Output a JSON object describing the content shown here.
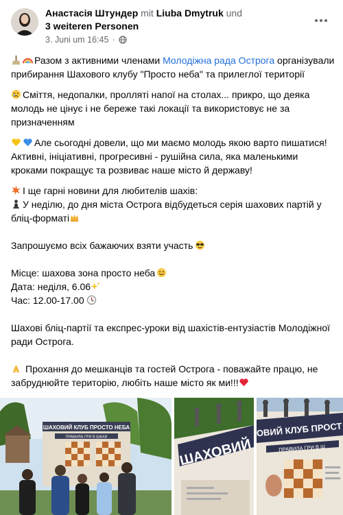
{
  "post": {
    "author": "Анастасія Штундер",
    "with_word": "mit",
    "tagged": "Liuba Dmytruk",
    "and_word": "und",
    "others": "3 weiteren Personen",
    "date": "3. Juni um 16:45",
    "audience_icon": "globe-icon",
    "more_icon": "more-options-icon"
  },
  "text": {
    "p1_a": "Разом з активними членами",
    "p1_link": "Молодіжна рада Острога",
    "p1_b": "організували прибирання Шахового клубу \"Просто неба\" та прилеглої території",
    "p2": "Сміття, недопалки, пролляті напої на столах... прикро, що деяка молодь не цінує і не береже такі локації та використовує не за призначенням",
    "p3": "Але сьогодні довели, що ми маємо молодь якою варто пишатися! Активні, ініціативні, прогресивні - рушійна сила, яка маленькими кроками покращує та розвиває наше місто й державу!",
    "p4": "І ще гарні новини для любителів шахів:",
    "p5": "У неділю, до дня міста Острога відбудеться серія шахових партій у бліц-форматі",
    "p6": "Запрошуємо всіх бажаючих взяти участь",
    "p7": "Місце: шахова зона просто неба",
    "p8": "Дата: неділя,  6.06",
    "p9": "Час: 12.00-17.00",
    "p10": "Шахові бліц-партії та експрес-уроки  від шахістів-ентузіастів Молодіжної ради Острога.",
    "p11": "Прохання до мешканців та гостей Острога - поважайте працю, не забруднюйте територію, любіть наше місто як ми!!!"
  },
  "photos": {
    "sign_line1": "ШАХОВИЙ КЛУБ ПРОСТО НЕБА",
    "sign_line2": "ПРАВИЛА ГРИ В ШАХИ",
    "sign_closeup_a": "ШАХОВИЙ",
    "sign_closeup_b": "ОВИЙ КЛУБ ПРОСТ",
    "sign_closeup_c": "ПРАВИЛА ГРИ В Ш"
  }
}
